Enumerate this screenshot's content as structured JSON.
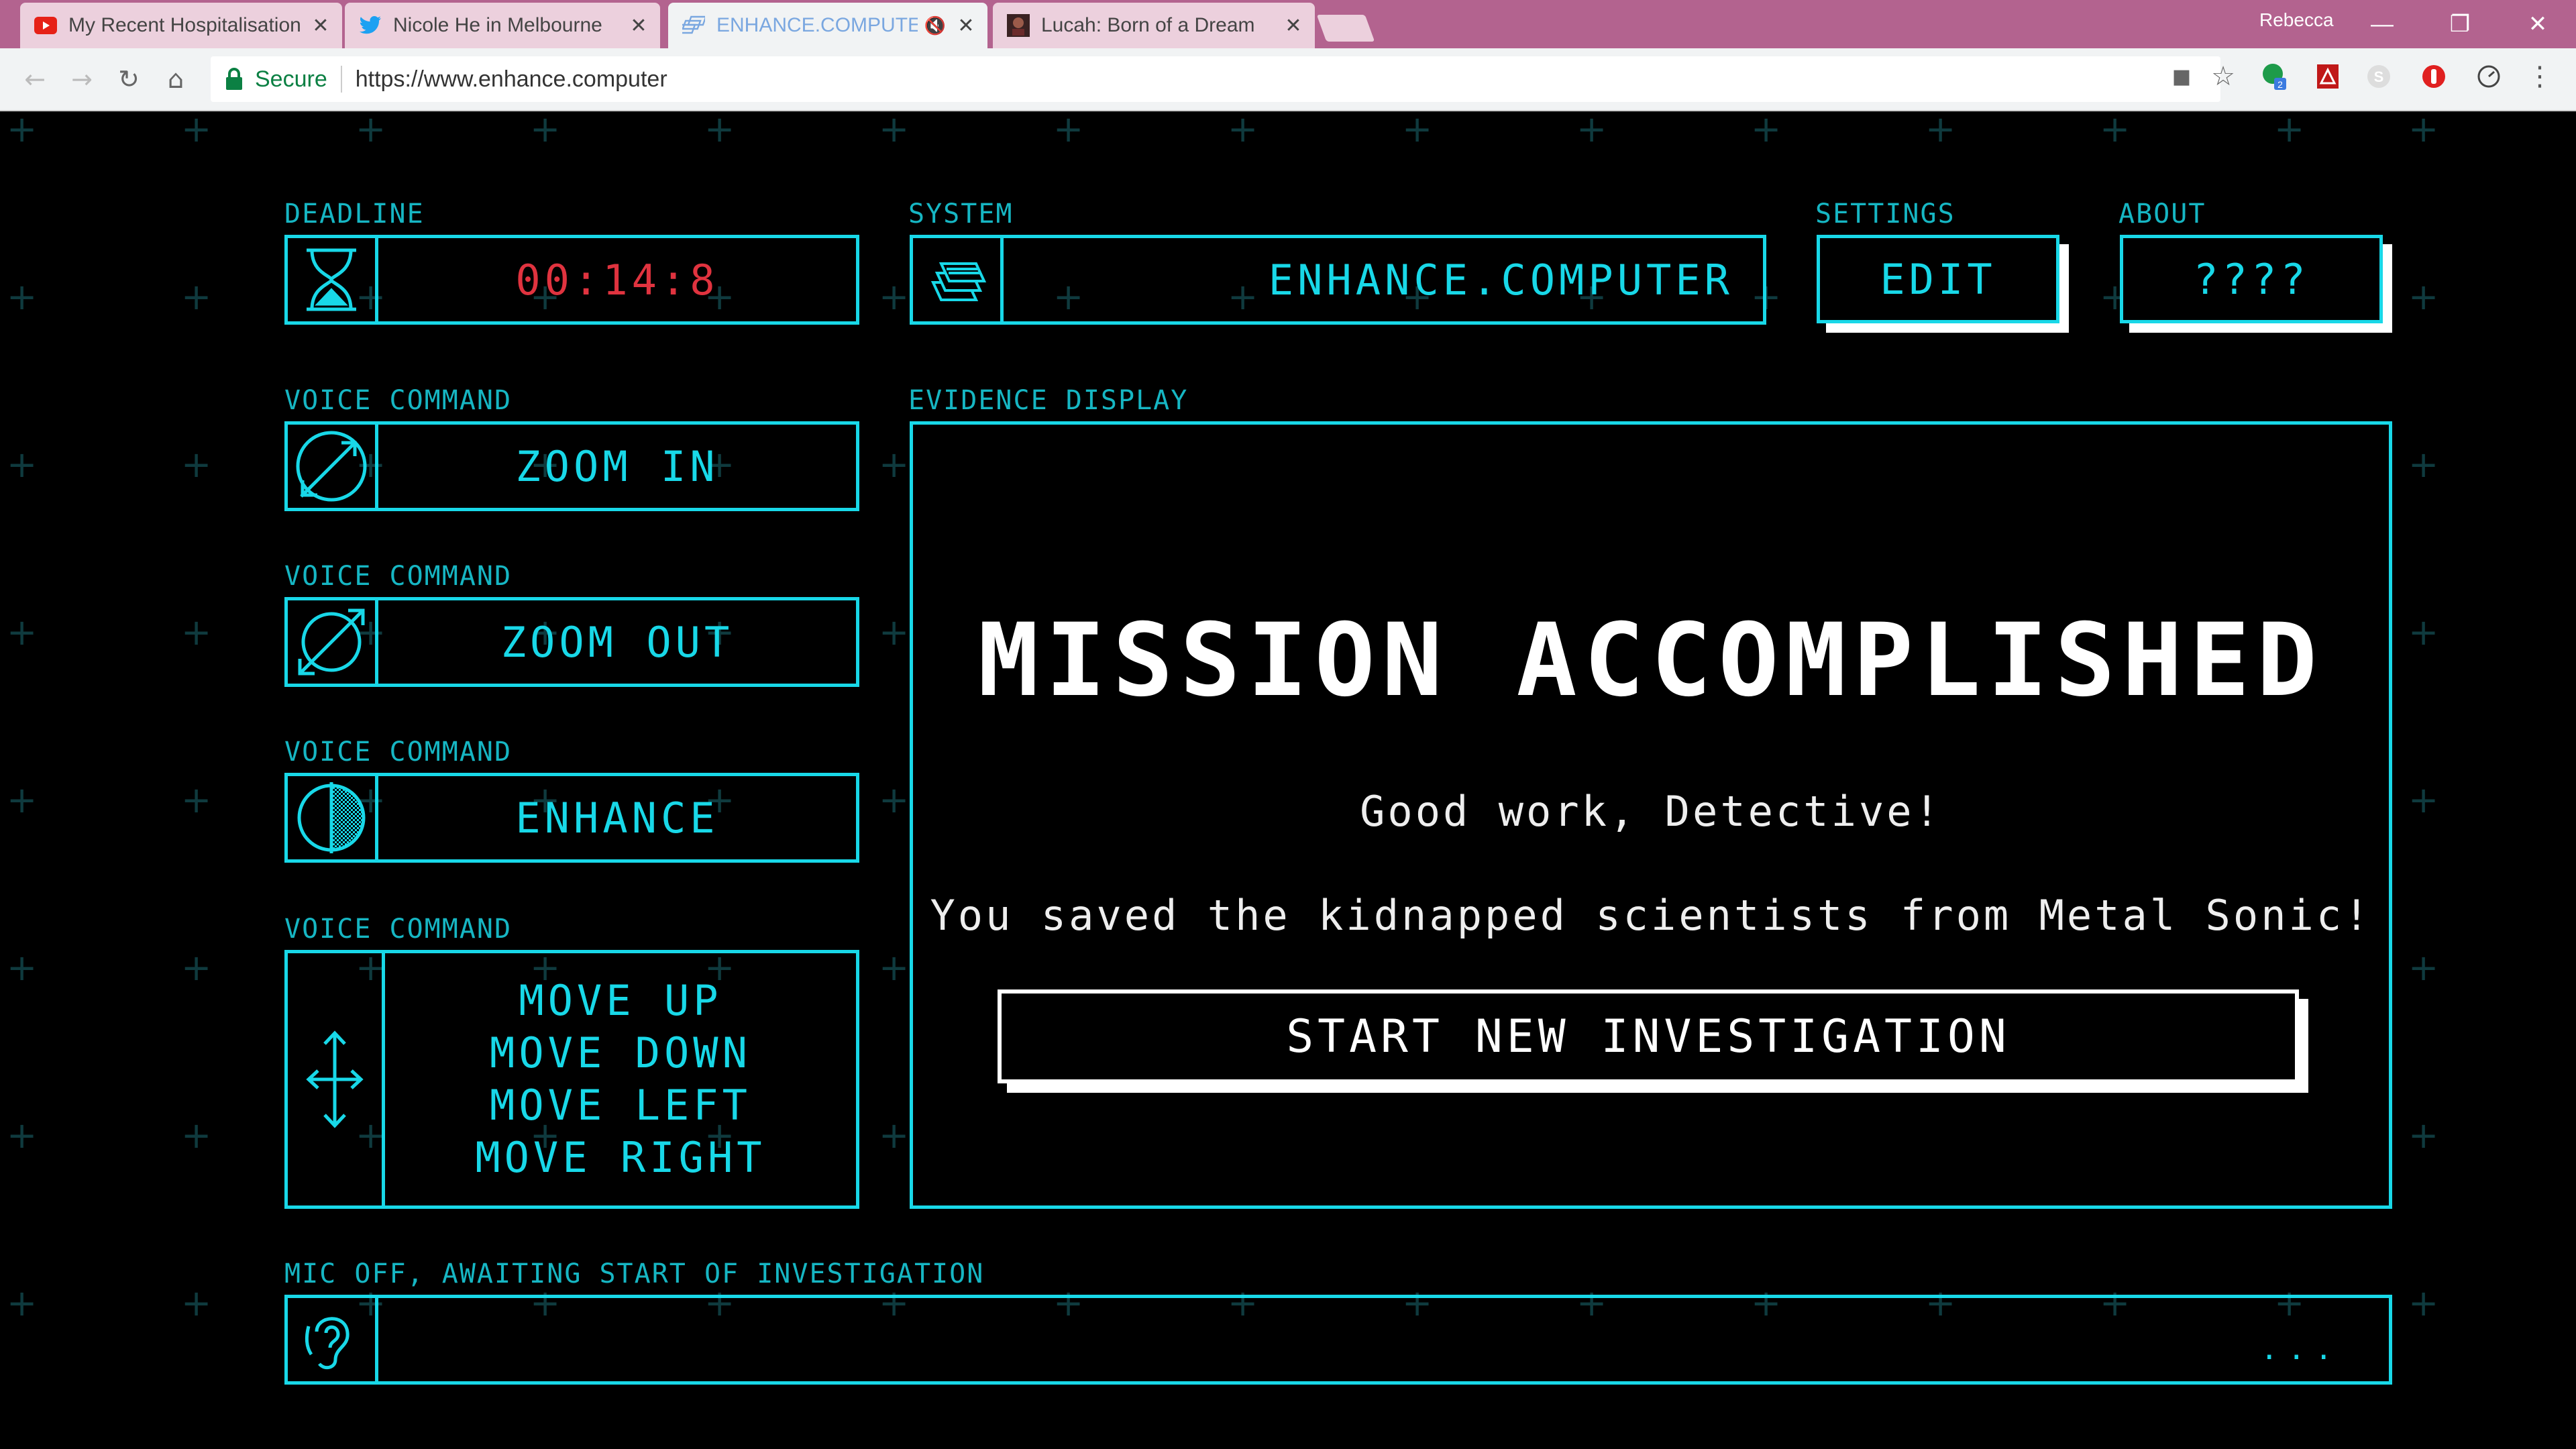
{
  "browser": {
    "tabs": [
      {
        "title": "My Recent Hospitalisation",
        "icon": "youtube-icon",
        "active": false
      },
      {
        "title": "Nicole He in Melbourne",
        "icon": "twitter-icon",
        "active": false
      },
      {
        "title": "ENHANCE.COMPUTER",
        "icon": "enhance-favicon-icon",
        "active": true,
        "muted": true
      },
      {
        "title": "Lucah: Born of a Dream",
        "icon": "game-thumbnail-icon",
        "active": false
      }
    ],
    "profile_name": "Rebecca",
    "security_label": "Secure",
    "url": "https://www.enhance.computer",
    "close_glyph": "✕",
    "mute_glyph": "🔇",
    "ext_badge": "2"
  },
  "app": {
    "deadline": {
      "label": "DEADLINE",
      "value": "00:14:8",
      "icon": "hourglass-icon"
    },
    "system": {
      "label": "SYSTEM",
      "value": "ENHANCE.COMPUTER",
      "icon": "stack-layers-icon"
    },
    "settings": {
      "label": "SETTINGS",
      "button": "EDIT"
    },
    "about": {
      "label": "ABOUT",
      "button": "????"
    },
    "voice_commands": [
      {
        "label": "VOICE COMMAND",
        "command": "ZOOM IN",
        "icon": "zoom-in-arrow-icon"
      },
      {
        "label": "VOICE COMMAND",
        "command": "ZOOM OUT",
        "icon": "zoom-out-arrow-icon"
      },
      {
        "label": "VOICE COMMAND",
        "command": "ENHANCE",
        "icon": "enhance-circle-icon"
      },
      {
        "label": "VOICE COMMAND",
        "commands": [
          "MOVE UP",
          "MOVE DOWN",
          "MOVE LEFT",
          "MOVE RIGHT"
        ],
        "icon": "move-arrows-icon"
      }
    ],
    "evidence": {
      "label": "EVIDENCE DISPLAY",
      "headline": "MISSION ACCOMPLISHED",
      "message1": "Good work, Detective!",
      "message2": "You saved the kidnapped scientists from Metal Sonic!",
      "button": "START NEW INVESTIGATION"
    },
    "mic": {
      "label": "MIC OFF, AWAITING START OF INVESTIGATION",
      "icon": "ear-icon",
      "status": "..."
    }
  },
  "colors": {
    "accent": "#18d8e8",
    "deadline": "#e0333f",
    "background": "#000000",
    "chrome": "#b3638f"
  }
}
